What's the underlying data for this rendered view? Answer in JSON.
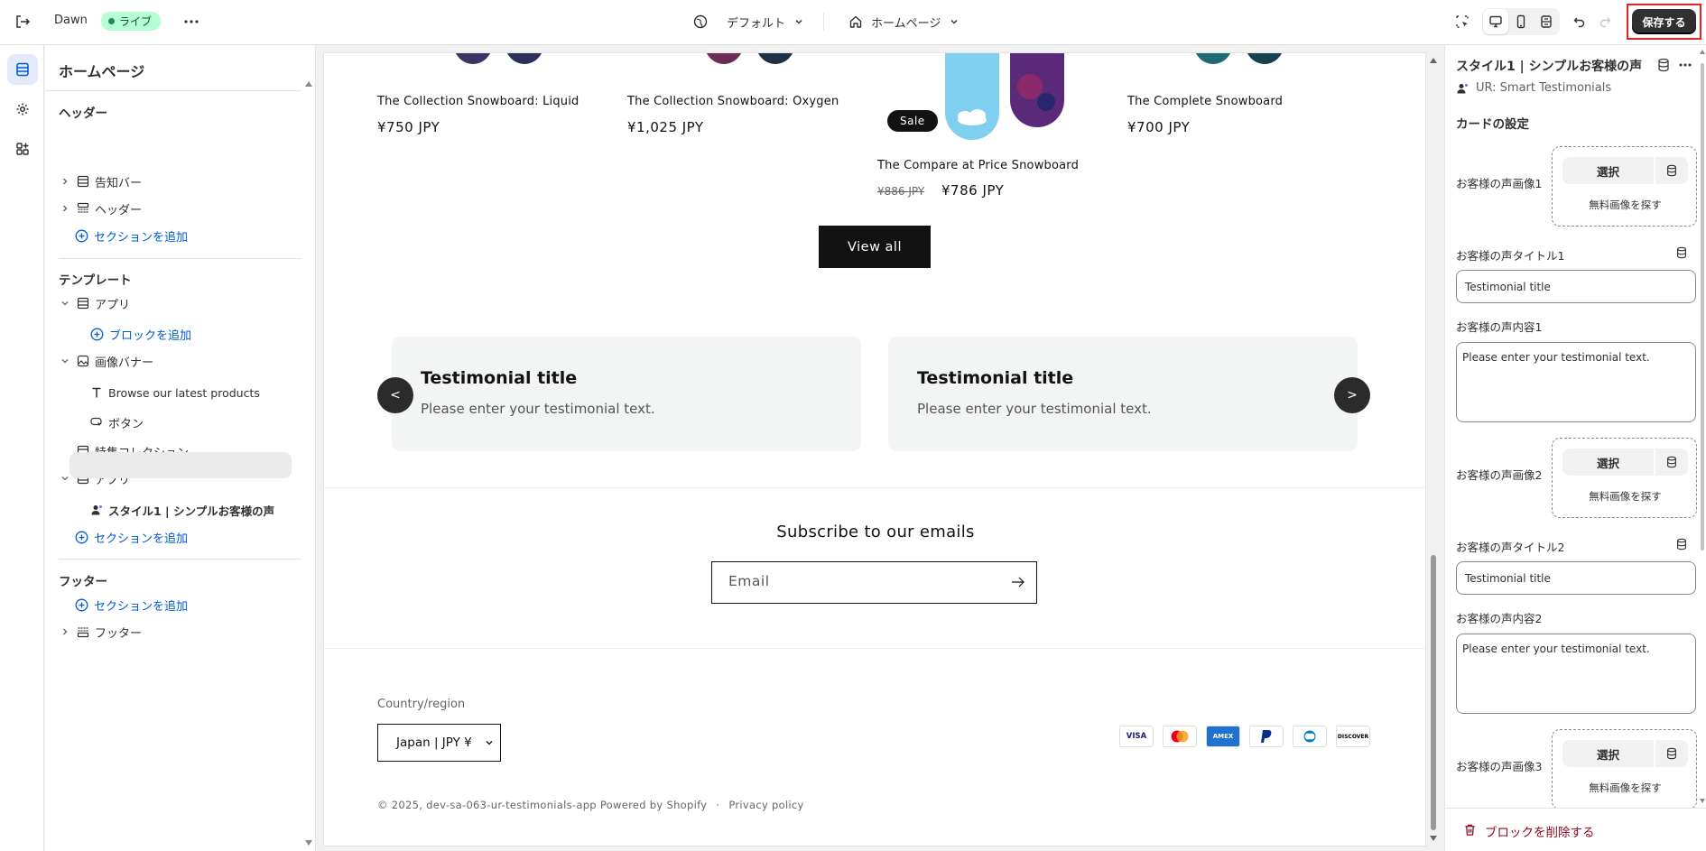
{
  "topbar": {
    "theme_name": "Dawn",
    "live_badge": "ライブ",
    "market_label": "デフォルト",
    "page_label": "ホームページ",
    "save_label": "保存する"
  },
  "left_panel": {
    "title": "ホームページ",
    "header_group": "ヘッダー",
    "announcement_bar": "告知バー",
    "header_item": "ヘッダー",
    "add_section_1": "セクションを追加",
    "template_group": "テンプレート",
    "app_1": "アプリ",
    "add_block": "ブロックを追加",
    "image_banner": "画像バナー",
    "browse_text": "Browse our latest products",
    "button_item": "ボタン",
    "featured_collection": "特集コレクション",
    "app_2": "アプリ",
    "selected_block": "スタイル1 | シンプルお客様の声",
    "add_section_2": "セクションを追加",
    "footer_group": "フッター",
    "add_section_3": "セクションを追加",
    "footer_item": "フッター"
  },
  "preview": {
    "products": [
      {
        "name": "The Collection Snowboard: Liquid",
        "price": "¥750 JPY"
      },
      {
        "name": "The Collection Snowboard: Oxygen",
        "price": "¥1,025 JPY"
      },
      {
        "name": "The Compare at Price Snowboard",
        "old_price": "¥886 JPY",
        "price": "¥786 JPY",
        "badge": "Sale"
      },
      {
        "name": "The Complete Snowboard",
        "price": "¥700 JPY"
      }
    ],
    "view_all": "View all",
    "testimonials": [
      {
        "title": "Testimonial title",
        "text": "Please enter your testimonial text."
      },
      {
        "title": "Testimonial title",
        "text": "Please enter your testimonial text."
      }
    ],
    "prev_arrow": "<",
    "next_arrow": ">",
    "subscribe_heading": "Subscribe to our emails",
    "email_placeholder": "Email",
    "country_label": "Country/region",
    "country_value": "Japan | JPY ¥",
    "payments": [
      "VISA",
      "MC",
      "AMEX",
      "PayPal",
      "Diners",
      "DISCOVER"
    ],
    "copyright": "© 2025, dev-sa-063-ur-testimonials-app Powered by Shopify",
    "privacy": "Privacy policy"
  },
  "right_panel": {
    "title": "スタイル1 | シンプルお客様の声",
    "app_name": "UR: Smart Testimonials",
    "card_settings": "カードの設定",
    "image1_label": "お客様の声画像1",
    "title1_label": "お客様の声タイトル1",
    "title1_value": "Testimonial title",
    "content1_label": "お客様の声内容1",
    "content1_value": "Please enter your testimonial text.",
    "image2_label": "お客様の声画像2",
    "title2_label": "お客様の声タイトル2",
    "title2_value": "Testimonial title",
    "content2_label": "お客様の声内容2",
    "content2_value": "Please enter your testimonial text.",
    "image3_label": "お客様の声画像3",
    "select_label": "選択",
    "free_images": "無料画像を探す",
    "delete_block": "ブロックを削除する"
  },
  "colors": {
    "accent": "#005bd3",
    "live_badge": "#b4fed2",
    "save_button": "#303030",
    "highlight": "#e02424"
  }
}
